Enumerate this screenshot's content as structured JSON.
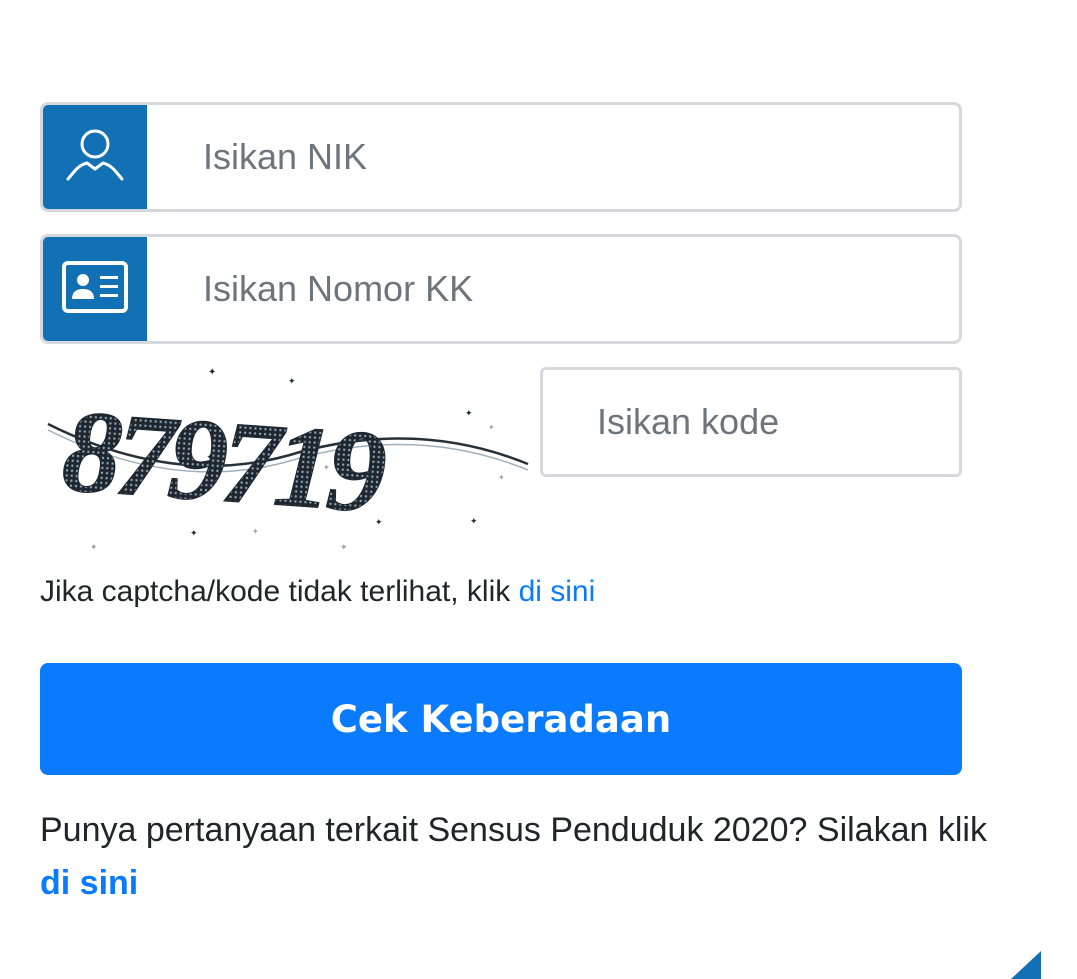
{
  "form": {
    "nik": {
      "placeholder": "Isikan NIK",
      "icon": "user-icon"
    },
    "kk": {
      "placeholder": "Isikan Nomor KK",
      "icon": "id-card-icon"
    },
    "captcha": {
      "code_text": "879719",
      "code_placeholder": "Isikan kode"
    },
    "captcha_help": {
      "text": "Jika captcha/kode tidak terlihat, klik ",
      "link": "di sini"
    },
    "submit_label": "Cek Keberadaan"
  },
  "faq": {
    "text": "Punya pertanyaan terkait Sensus Penduduk 2020? Silakan klik ",
    "link": "di sini"
  },
  "colors": {
    "addon": "#1270b5",
    "primary": "#0a7bff",
    "border": "#d5d8dc"
  }
}
